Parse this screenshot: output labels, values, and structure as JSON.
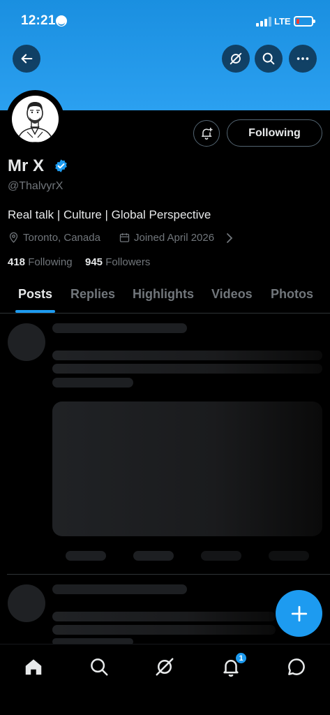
{
  "status_bar": {
    "time": "12:21",
    "network": "LTE"
  },
  "header": {
    "back_icon": "back-arrow-icon",
    "grok_icon": "grok-icon",
    "search_icon": "search-icon",
    "more_icon": "more-icon"
  },
  "profile": {
    "name": "Mr X",
    "handle": "@ThalvyrX",
    "bio": "Real talk | Culture | Global Perspective",
    "location": "Toronto, Canada",
    "joined": "Joined April 2026",
    "following_count": "418",
    "following_label": "Following",
    "followers_count": "945",
    "followers_label": "Followers",
    "follow_button_label": "Following"
  },
  "tabs": [
    {
      "label": "Posts",
      "active": true
    },
    {
      "label": "Replies",
      "active": false
    },
    {
      "label": "Highlights",
      "active": false
    },
    {
      "label": "Videos",
      "active": false
    },
    {
      "label": "Photos",
      "active": false
    }
  ],
  "bottom_nav": {
    "items": [
      "home-icon",
      "search-icon",
      "grok-icon",
      "notifications-icon",
      "messages-icon"
    ],
    "notification_badge": "1"
  },
  "colors": {
    "accent": "#1d9bf0",
    "banner": "#2ba0f0",
    "background": "#000000",
    "muted": "#71767b"
  }
}
